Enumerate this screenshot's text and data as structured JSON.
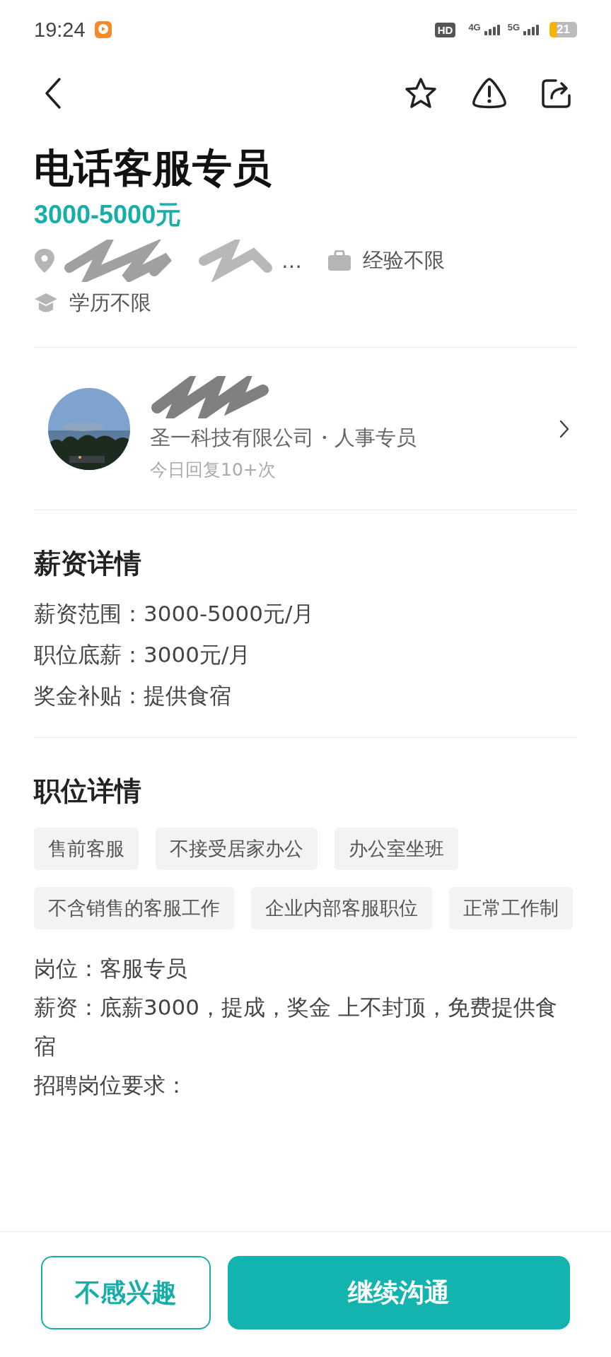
{
  "status_bar": {
    "time": "19:24",
    "battery": "21",
    "network_labels": [
      "HD",
      "4G",
      "5G"
    ]
  },
  "header": {
    "favorited": false
  },
  "job": {
    "title": "电话客服专员",
    "salary": "3000-5000元",
    "location": "…",
    "experience": "经验不限",
    "education": "学历不限"
  },
  "recruiter": {
    "company_role": "圣一科技有限公司・人事专员",
    "reply_note": "今日回复10+次"
  },
  "salary_details": {
    "heading": "薪资详情",
    "lines": [
      {
        "label": "薪资范围：",
        "value": "3000-5000元/月"
      },
      {
        "label": "职位底薪：",
        "value": "3000元/月"
      },
      {
        "label": "奖金补贴：",
        "value": "提供食宿"
      }
    ]
  },
  "job_details": {
    "heading": "职位详情",
    "tags": [
      "售前客服",
      "不接受居家办公",
      "办公室坐班",
      "不含销售的客服工作",
      "企业内部客服职位",
      "正常工作制"
    ],
    "description": [
      "岗位：客服专员",
      "薪资：底薪3000，提成，奖金 上不封顶，免费提供食宿",
      "招聘岗位要求："
    ]
  },
  "actions": [
    {
      "label": "不感兴趣",
      "kind": "outline"
    },
    {
      "label": "继续沟通",
      "kind": "primary"
    }
  ]
}
